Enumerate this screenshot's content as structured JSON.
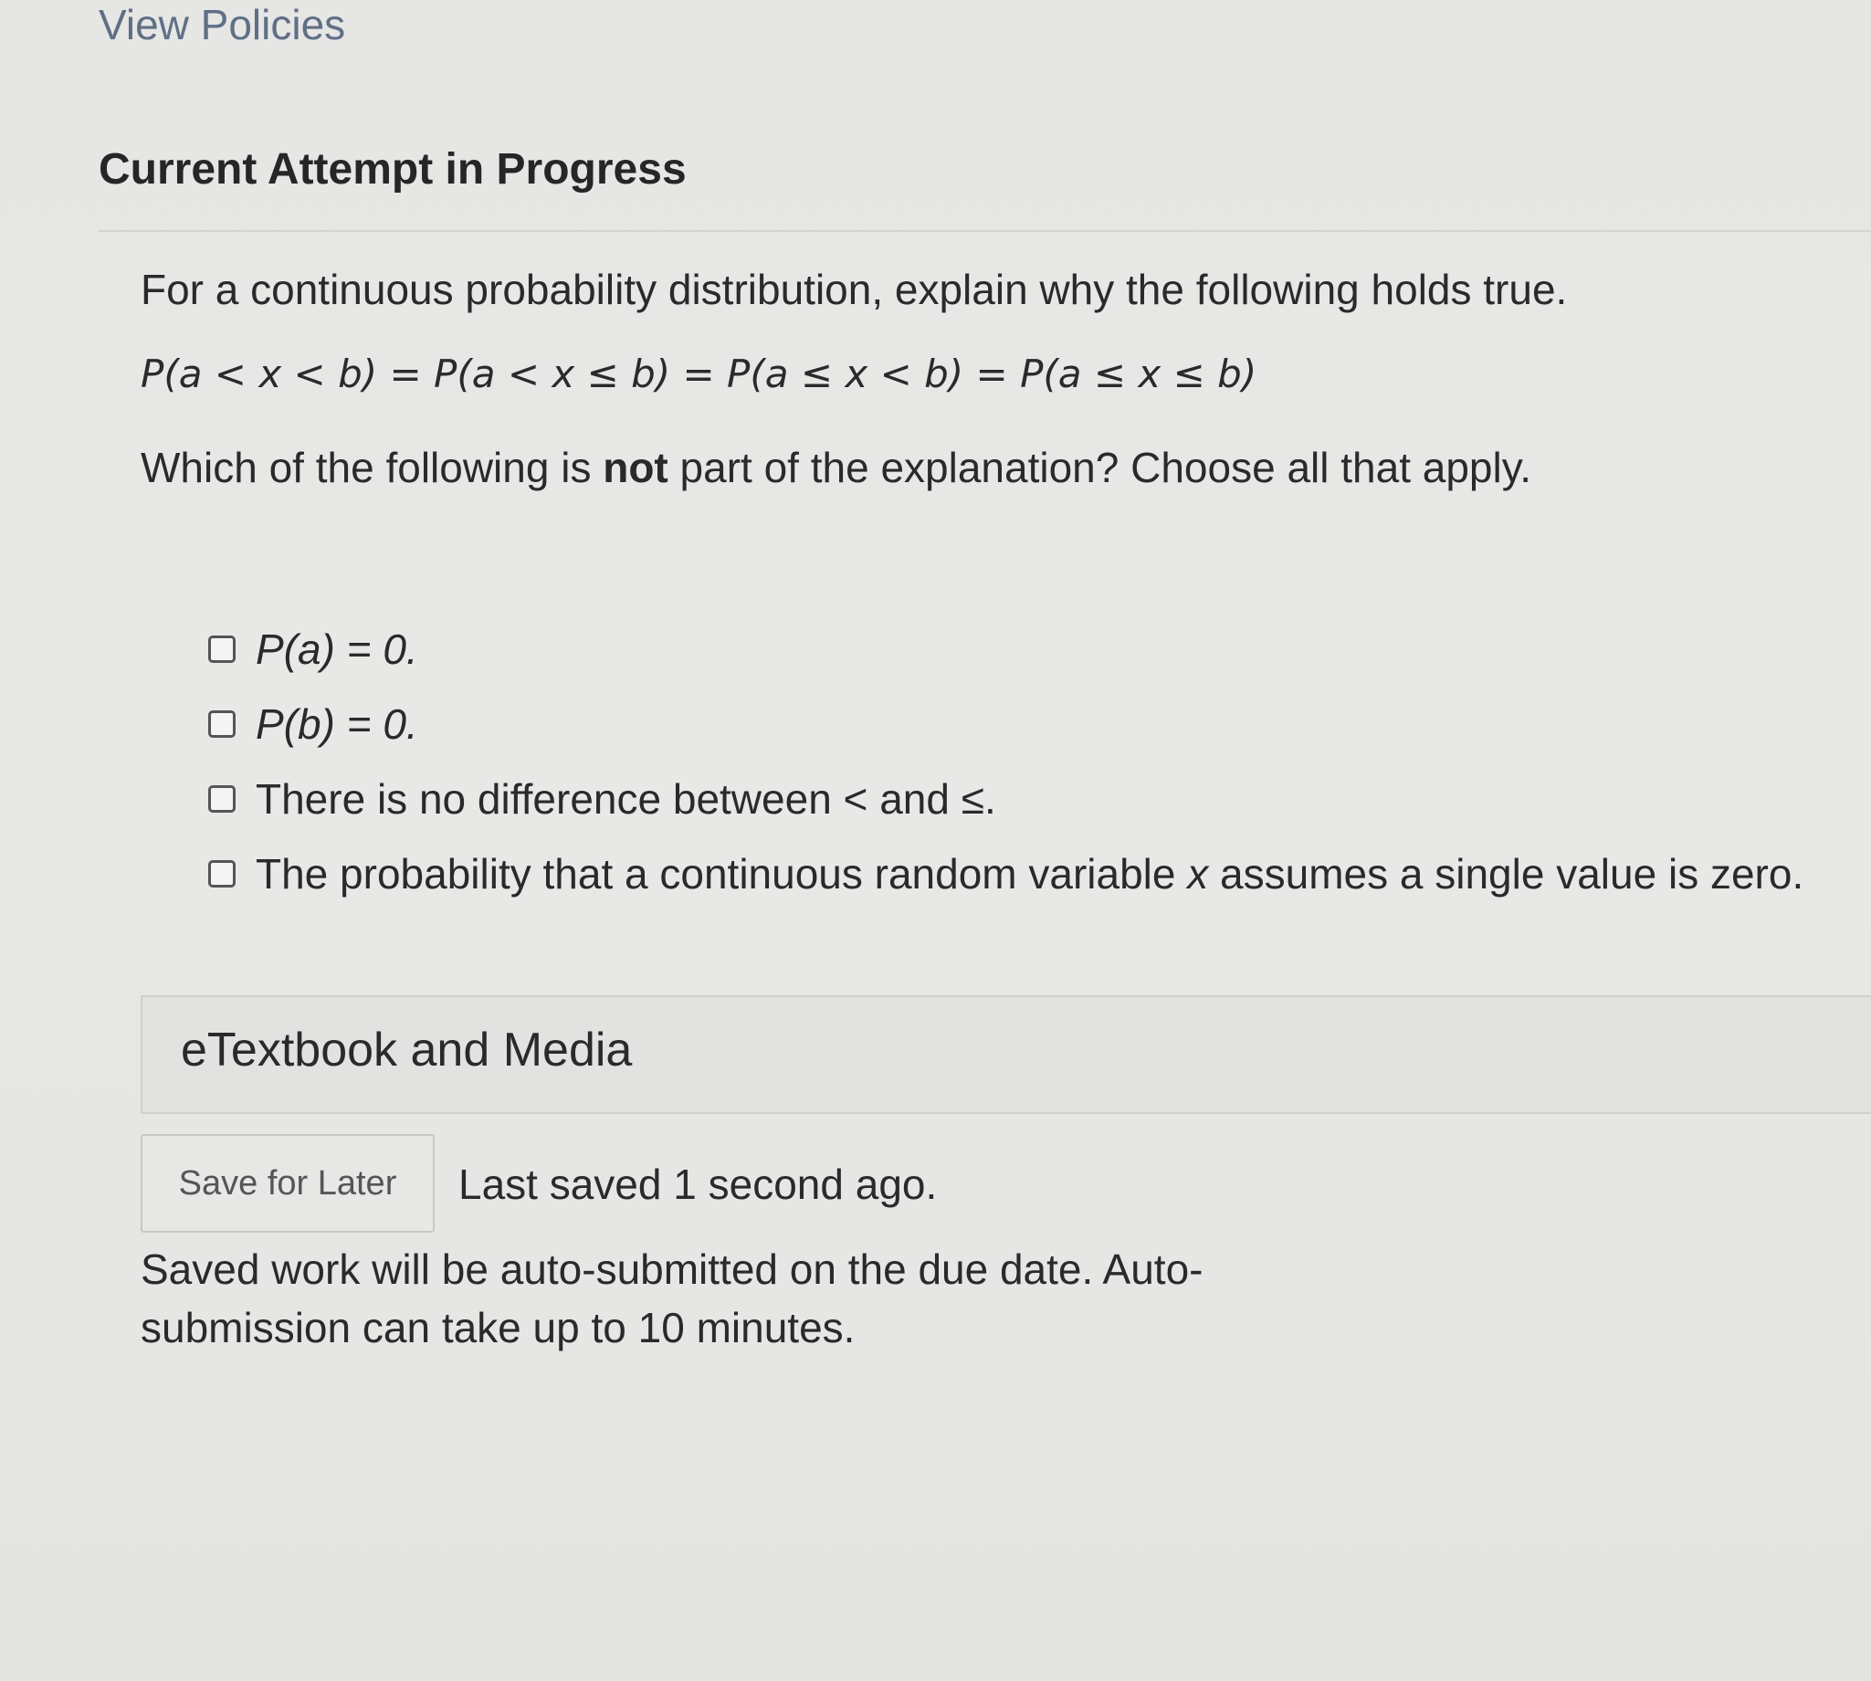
{
  "header": {
    "view_policies_link": "View Policies",
    "attempt_title": "Current Attempt in Progress"
  },
  "question": {
    "prompt": "For a continuous probability distribution, explain why the following holds true.",
    "equation": "P(a < x < b) = P(a < x ≤ b) = P(a ≤ x < b) = P(a ≤ x ≤ b)",
    "instruction_before": "Which of the following is ",
    "instruction_bold": "not",
    "instruction_after": " part of the explanation? Choose all that apply."
  },
  "options": [
    {
      "label": "P(a) = 0.",
      "checked": false
    },
    {
      "label": "P(b) = 0.",
      "checked": false
    },
    {
      "label": "There is no difference between < and ≤.",
      "checked": false
    },
    {
      "label_before": "The probability that a continuous random variable ",
      "label_italic": "x",
      "label_after": " assumes a single value is zero.",
      "checked": false
    }
  ],
  "etextbook": {
    "label": "eTextbook and Media"
  },
  "save": {
    "button_label": "Save for Later",
    "status": "Last saved 1 second ago.",
    "note": "Saved work will be auto-submitted on the due date. Auto-submission can take up to 10 minutes."
  }
}
